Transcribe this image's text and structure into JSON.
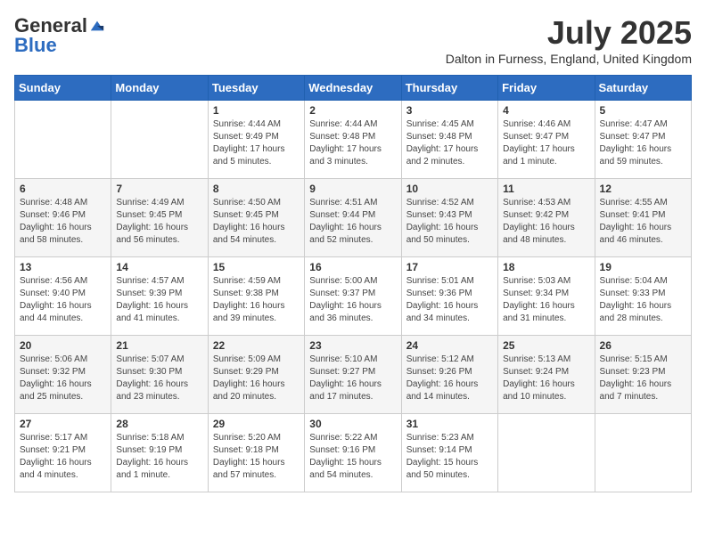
{
  "header": {
    "logo_general": "General",
    "logo_blue": "Blue",
    "month_title": "July 2025",
    "subtitle": "Dalton in Furness, England, United Kingdom"
  },
  "weekdays": [
    "Sunday",
    "Monday",
    "Tuesday",
    "Wednesday",
    "Thursday",
    "Friday",
    "Saturday"
  ],
  "weeks": [
    [
      {
        "day": "",
        "sunrise": "",
        "sunset": "",
        "daylight": ""
      },
      {
        "day": "",
        "sunrise": "",
        "sunset": "",
        "daylight": ""
      },
      {
        "day": "1",
        "sunrise": "Sunrise: 4:44 AM",
        "sunset": "Sunset: 9:49 PM",
        "daylight": "Daylight: 17 hours and 5 minutes."
      },
      {
        "day": "2",
        "sunrise": "Sunrise: 4:44 AM",
        "sunset": "Sunset: 9:48 PM",
        "daylight": "Daylight: 17 hours and 3 minutes."
      },
      {
        "day": "3",
        "sunrise": "Sunrise: 4:45 AM",
        "sunset": "Sunset: 9:48 PM",
        "daylight": "Daylight: 17 hours and 2 minutes."
      },
      {
        "day": "4",
        "sunrise": "Sunrise: 4:46 AM",
        "sunset": "Sunset: 9:47 PM",
        "daylight": "Daylight: 17 hours and 1 minute."
      },
      {
        "day": "5",
        "sunrise": "Sunrise: 4:47 AM",
        "sunset": "Sunset: 9:47 PM",
        "daylight": "Daylight: 16 hours and 59 minutes."
      }
    ],
    [
      {
        "day": "6",
        "sunrise": "Sunrise: 4:48 AM",
        "sunset": "Sunset: 9:46 PM",
        "daylight": "Daylight: 16 hours and 58 minutes."
      },
      {
        "day": "7",
        "sunrise": "Sunrise: 4:49 AM",
        "sunset": "Sunset: 9:45 PM",
        "daylight": "Daylight: 16 hours and 56 minutes."
      },
      {
        "day": "8",
        "sunrise": "Sunrise: 4:50 AM",
        "sunset": "Sunset: 9:45 PM",
        "daylight": "Daylight: 16 hours and 54 minutes."
      },
      {
        "day": "9",
        "sunrise": "Sunrise: 4:51 AM",
        "sunset": "Sunset: 9:44 PM",
        "daylight": "Daylight: 16 hours and 52 minutes."
      },
      {
        "day": "10",
        "sunrise": "Sunrise: 4:52 AM",
        "sunset": "Sunset: 9:43 PM",
        "daylight": "Daylight: 16 hours and 50 minutes."
      },
      {
        "day": "11",
        "sunrise": "Sunrise: 4:53 AM",
        "sunset": "Sunset: 9:42 PM",
        "daylight": "Daylight: 16 hours and 48 minutes."
      },
      {
        "day": "12",
        "sunrise": "Sunrise: 4:55 AM",
        "sunset": "Sunset: 9:41 PM",
        "daylight": "Daylight: 16 hours and 46 minutes."
      }
    ],
    [
      {
        "day": "13",
        "sunrise": "Sunrise: 4:56 AM",
        "sunset": "Sunset: 9:40 PM",
        "daylight": "Daylight: 16 hours and 44 minutes."
      },
      {
        "day": "14",
        "sunrise": "Sunrise: 4:57 AM",
        "sunset": "Sunset: 9:39 PM",
        "daylight": "Daylight: 16 hours and 41 minutes."
      },
      {
        "day": "15",
        "sunrise": "Sunrise: 4:59 AM",
        "sunset": "Sunset: 9:38 PM",
        "daylight": "Daylight: 16 hours and 39 minutes."
      },
      {
        "day": "16",
        "sunrise": "Sunrise: 5:00 AM",
        "sunset": "Sunset: 9:37 PM",
        "daylight": "Daylight: 16 hours and 36 minutes."
      },
      {
        "day": "17",
        "sunrise": "Sunrise: 5:01 AM",
        "sunset": "Sunset: 9:36 PM",
        "daylight": "Daylight: 16 hours and 34 minutes."
      },
      {
        "day": "18",
        "sunrise": "Sunrise: 5:03 AM",
        "sunset": "Sunset: 9:34 PM",
        "daylight": "Daylight: 16 hours and 31 minutes."
      },
      {
        "day": "19",
        "sunrise": "Sunrise: 5:04 AM",
        "sunset": "Sunset: 9:33 PM",
        "daylight": "Daylight: 16 hours and 28 minutes."
      }
    ],
    [
      {
        "day": "20",
        "sunrise": "Sunrise: 5:06 AM",
        "sunset": "Sunset: 9:32 PM",
        "daylight": "Daylight: 16 hours and 25 minutes."
      },
      {
        "day": "21",
        "sunrise": "Sunrise: 5:07 AM",
        "sunset": "Sunset: 9:30 PM",
        "daylight": "Daylight: 16 hours and 23 minutes."
      },
      {
        "day": "22",
        "sunrise": "Sunrise: 5:09 AM",
        "sunset": "Sunset: 9:29 PM",
        "daylight": "Daylight: 16 hours and 20 minutes."
      },
      {
        "day": "23",
        "sunrise": "Sunrise: 5:10 AM",
        "sunset": "Sunset: 9:27 PM",
        "daylight": "Daylight: 16 hours and 17 minutes."
      },
      {
        "day": "24",
        "sunrise": "Sunrise: 5:12 AM",
        "sunset": "Sunset: 9:26 PM",
        "daylight": "Daylight: 16 hours and 14 minutes."
      },
      {
        "day": "25",
        "sunrise": "Sunrise: 5:13 AM",
        "sunset": "Sunset: 9:24 PM",
        "daylight": "Daylight: 16 hours and 10 minutes."
      },
      {
        "day": "26",
        "sunrise": "Sunrise: 5:15 AM",
        "sunset": "Sunset: 9:23 PM",
        "daylight": "Daylight: 16 hours and 7 minutes."
      }
    ],
    [
      {
        "day": "27",
        "sunrise": "Sunrise: 5:17 AM",
        "sunset": "Sunset: 9:21 PM",
        "daylight": "Daylight: 16 hours and 4 minutes."
      },
      {
        "day": "28",
        "sunrise": "Sunrise: 5:18 AM",
        "sunset": "Sunset: 9:19 PM",
        "daylight": "Daylight: 16 hours and 1 minute."
      },
      {
        "day": "29",
        "sunrise": "Sunrise: 5:20 AM",
        "sunset": "Sunset: 9:18 PM",
        "daylight": "Daylight: 15 hours and 57 minutes."
      },
      {
        "day": "30",
        "sunrise": "Sunrise: 5:22 AM",
        "sunset": "Sunset: 9:16 PM",
        "daylight": "Daylight: 15 hours and 54 minutes."
      },
      {
        "day": "31",
        "sunrise": "Sunrise: 5:23 AM",
        "sunset": "Sunset: 9:14 PM",
        "daylight": "Daylight: 15 hours and 50 minutes."
      },
      {
        "day": "",
        "sunrise": "",
        "sunset": "",
        "daylight": ""
      },
      {
        "day": "",
        "sunrise": "",
        "sunset": "",
        "daylight": ""
      }
    ]
  ]
}
